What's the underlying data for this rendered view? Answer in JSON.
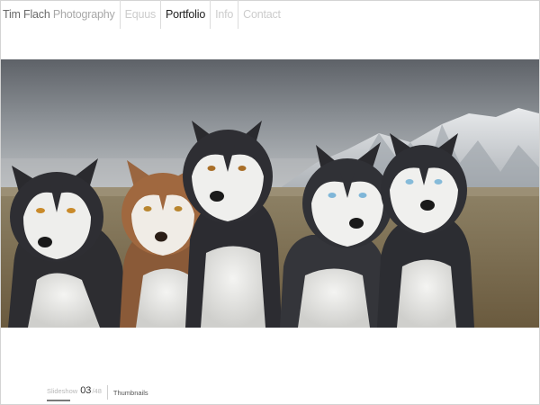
{
  "nav": {
    "brand_first": "Tim Flach",
    "brand_second": "Photography",
    "items": [
      {
        "label": "Equus",
        "state": "muted"
      },
      {
        "label": "Portfolio",
        "state": "active"
      },
      {
        "label": "Info",
        "state": "muted"
      },
      {
        "label": "Contact",
        "state": "muted"
      }
    ]
  },
  "photo": {
    "subject": "five siberian husky dogs in front of snowy mountains"
  },
  "footer": {
    "slideshow_label": "Slideshow",
    "current_number": "03",
    "total_number": "/48",
    "thumbnails_label": "Thumbnails"
  },
  "colors": {
    "active_nav": "#222222",
    "muted_nav": "#cccccc",
    "divider": "#dcdcdc"
  }
}
